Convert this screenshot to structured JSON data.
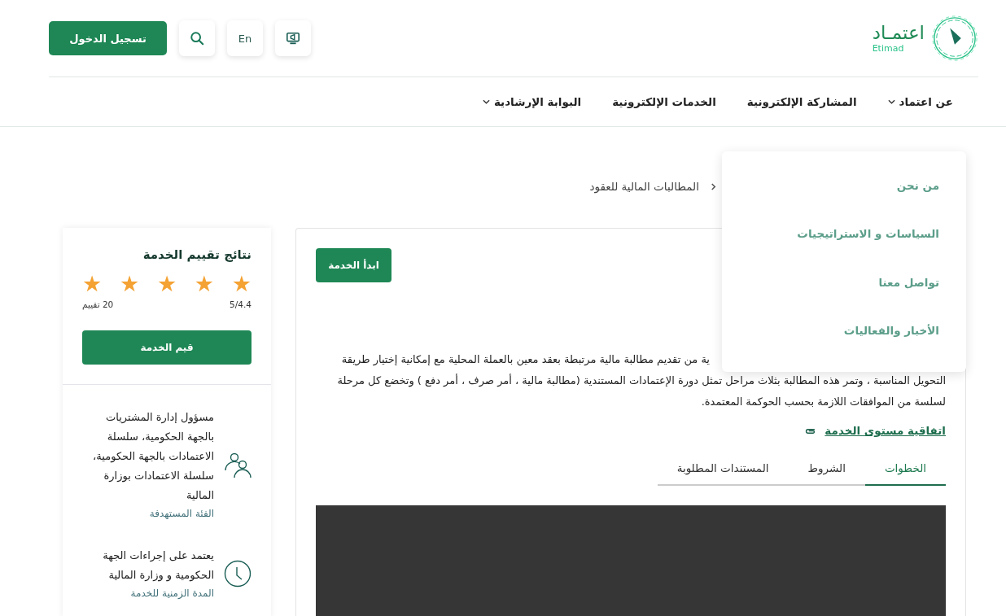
{
  "header": {
    "logo": {
      "text": "اعتمـاد",
      "subtext": "Etimad"
    },
    "login_button": "تسجيل الدخول",
    "language_button": "En"
  },
  "nav": [
    {
      "label": "عن اعتماد",
      "dropdown": true
    },
    {
      "label": "المشاركة الإلكترونية",
      "dropdown": false
    },
    {
      "label": "الخدمات الإلكترونية",
      "dropdown": false
    },
    {
      "label": "البوابة الإرشادية",
      "dropdown": true
    }
  ],
  "dropdown_menu": [
    "من نحن",
    "السياسات و الاستراتيجيات",
    "تواصل معنا",
    "الأخبار والفعاليات"
  ],
  "breadcrumb": [
    "المطالبات المالية للعقود"
  ],
  "service": {
    "start_button": "ابدأ الخدمة",
    "description": "ية من تقديم مطالبة مالية مرتبطة بعقد معين بالعملة المحلية مع إمكانية إختيار طريقة التحويل المناسبة ، وتمر هذه المطالبة بثلاث مراحل تمثل دورة الإعتمادات المستندية (مطالبة مالية ، أمر صرف ، أمر دفع ) وتخضع كل مرحلة لسلسة من الموافقات اللازمة بحسب الحوكمة المعتمدة.",
    "sla_link": "اتفاقية مستوى الخدمة",
    "tabs": [
      {
        "label": "الخطوات",
        "selected": true
      },
      {
        "label": "الشروط",
        "selected": false
      },
      {
        "label": "المستندات المطلوبة",
        "selected": false
      }
    ]
  },
  "rating": {
    "title": "نتائج تقييم الخدمة",
    "stars": 5,
    "score": "5/4.4",
    "count": "20 تقييم",
    "rate_button": "قيم الخدمة"
  },
  "info": [
    {
      "kind": "people",
      "text": "مسؤول إدارة المشتريات بالجهة الحكومية، سلسلة الاعتمادات بالجهة الحكومية، سلسلة الاعتمادات بوزارة المالية",
      "label": "الفئة المستهدفة"
    },
    {
      "kind": "clock",
      "text": "يعتمد على إجراءات الجهة الحكومية و وزارة المالية",
      "label": "المدة الزمنية للخدمة"
    }
  ]
}
